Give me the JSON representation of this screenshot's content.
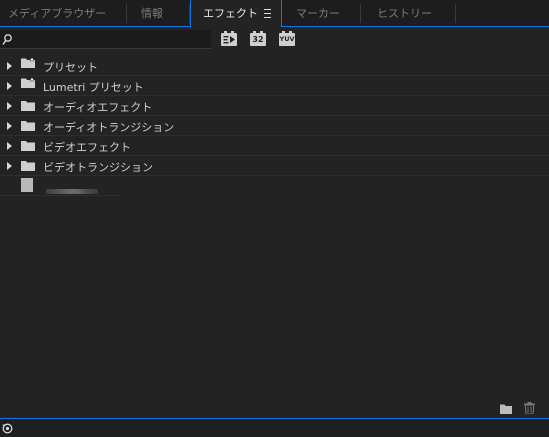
{
  "tabs": [
    {
      "label": "メディアブラウザー",
      "active": false
    },
    {
      "label": "情報",
      "active": false
    },
    {
      "label": "エフェクト",
      "active": true
    },
    {
      "label": "マーカー",
      "active": false
    },
    {
      "label": "ヒストリー",
      "active": false
    }
  ],
  "toolbar": {
    "search_value": "",
    "filter_buttons": [
      {
        "label": "",
        "icon": "accelerated-effects-icon"
      },
      {
        "label": "32",
        "icon": "32bit-color-icon"
      },
      {
        "label": "YUV",
        "icon": "yuv-effects-icon"
      }
    ]
  },
  "tree": [
    {
      "label": "プリセット",
      "icon": "preset-folder-icon"
    },
    {
      "label": "Lumetri プリセット",
      "icon": "preset-folder-icon"
    },
    {
      "label": "オーディオエフェクト",
      "icon": "folder-icon"
    },
    {
      "label": "オーディオトランジション",
      "icon": "folder-icon"
    },
    {
      "label": "ビデオエフェクト",
      "icon": "folder-icon"
    },
    {
      "label": "ビデオトランジション",
      "icon": "folder-icon"
    }
  ],
  "colors": {
    "accent": "#1473e6",
    "panel_bg": "#232323",
    "tab_bg": "#1d1d1d",
    "text": "#d0d0d0"
  }
}
